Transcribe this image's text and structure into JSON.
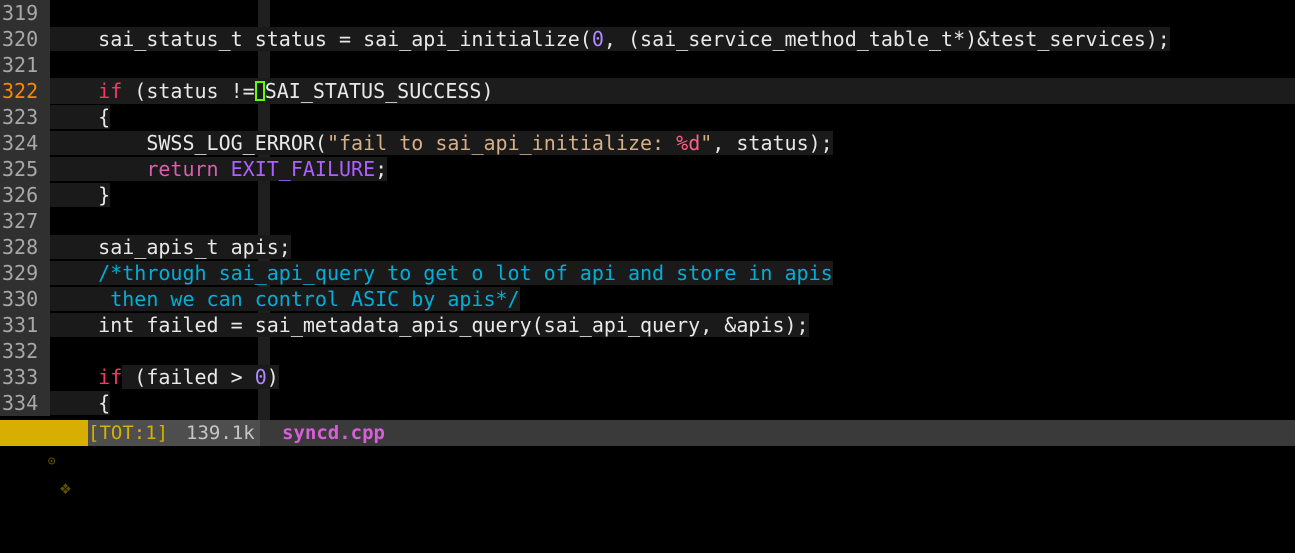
{
  "editor": {
    "lines": [
      {
        "num": "319",
        "current": false,
        "tokens": []
      },
      {
        "num": "320",
        "current": false,
        "tokens": [
          {
            "t": "    sai_status_t status = sai_api_initialize(",
            "c": "type",
            "bg": true
          },
          {
            "t": "0",
            "c": "num",
            "bg": true
          },
          {
            "t": ", (sai_service_method_table_t*)&test_services);",
            "c": "type",
            "bg": true
          }
        ]
      },
      {
        "num": "321",
        "current": false,
        "tokens": []
      },
      {
        "num": "322",
        "current": true,
        "tokens": [
          {
            "t": "    ",
            "c": "type"
          },
          {
            "t": "if",
            "c": "kw"
          },
          {
            "t": " (status !=",
            "c": "type"
          },
          {
            "t": "",
            "c": "cursor"
          },
          {
            "t": "SAI_STATUS_SUCCESS)",
            "c": "type"
          }
        ]
      },
      {
        "num": "323",
        "current": false,
        "tokens": [
          {
            "t": "    {",
            "c": "type",
            "bg": true
          }
        ]
      },
      {
        "num": "324",
        "current": false,
        "tokens": [
          {
            "t": "        SWSS_LOG_ERROR(",
            "c": "type",
            "bg": true
          },
          {
            "t": "\"fail to sai_api_initialize: ",
            "c": "str",
            "bg": true
          },
          {
            "t": "%d",
            "c": "fmt",
            "bg": true
          },
          {
            "t": "\"",
            "c": "str",
            "bg": true
          },
          {
            "t": ", status);",
            "c": "type",
            "bg": true
          }
        ]
      },
      {
        "num": "325",
        "current": false,
        "tokens": [
          {
            "t": "        ",
            "c": "type",
            "bg": true
          },
          {
            "t": "return",
            "c": "kw2",
            "bg": true
          },
          {
            "t": " ",
            "c": "type",
            "bg": true
          },
          {
            "t": "EXIT_FAILURE",
            "c": "macro",
            "bg": true
          },
          {
            "t": ";",
            "c": "type",
            "bg": true
          }
        ]
      },
      {
        "num": "326",
        "current": false,
        "tokens": [
          {
            "t": "    }",
            "c": "type",
            "bg": true
          }
        ]
      },
      {
        "num": "327",
        "current": false,
        "tokens": []
      },
      {
        "num": "328",
        "current": false,
        "tokens": [
          {
            "t": "    sai_apis_t apis;",
            "c": "type",
            "bg": true
          }
        ]
      },
      {
        "num": "329",
        "current": false,
        "tokens": [
          {
            "t": "    /*through sai_api_query to get o lot of api and store in apis",
            "c": "comment",
            "bg": true
          }
        ]
      },
      {
        "num": "330",
        "current": false,
        "tokens": [
          {
            "t": "     then we can control ASIC by apis*/",
            "c": "comment",
            "bg": true
          }
        ]
      },
      {
        "num": "331",
        "current": false,
        "tokens": [
          {
            "t": "    int failed = sai_metadata_apis_query(sai_api_query, &apis);",
            "c": "type",
            "bg": true
          }
        ]
      },
      {
        "num": "332",
        "current": false,
        "tokens": []
      },
      {
        "num": "333",
        "current": false,
        "tokens": [
          {
            "t": "    ",
            "c": "type"
          },
          {
            "t": "if",
            "c": "kw"
          },
          {
            "t": " (failed > ",
            "c": "type",
            "bg": true
          },
          {
            "t": "0",
            "c": "num",
            "bg": true
          },
          {
            "t": ")",
            "c": "type",
            "bg": true
          }
        ]
      },
      {
        "num": "334",
        "current": false,
        "tokens": [
          {
            "t": "    {",
            "c": "type",
            "bg": true
          }
        ]
      }
    ]
  },
  "statusbar": {
    "mode_icon": "⊙",
    "warn_icon": "❖",
    "warn_count": "1",
    "tot": "[TOT:1]",
    "size": "139.1k",
    "filename": "syncd.cpp"
  }
}
